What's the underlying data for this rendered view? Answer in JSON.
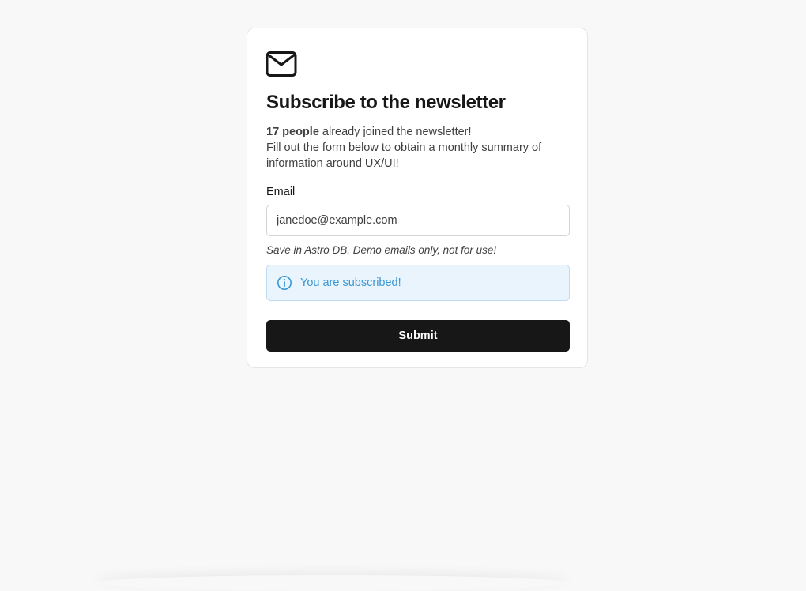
{
  "newsletter": {
    "icon": "mail-icon",
    "title": "Subscribe to the newsletter",
    "count_text": "17 people",
    "joined_text": " already joined the newsletter!",
    "description": "Fill out the form below to obtain a monthly summary of information around UX/UI!",
    "email_label": "Email",
    "email_value": "janedoe@example.com",
    "hint": "Save in Astro DB. Demo emails only, not for use!",
    "alert": {
      "icon": "info-icon",
      "text": "You are subscribed!",
      "color": "#3a97d4",
      "background": "#eaf4fd"
    },
    "submit_label": "Submit",
    "submit_color": "#171717"
  }
}
